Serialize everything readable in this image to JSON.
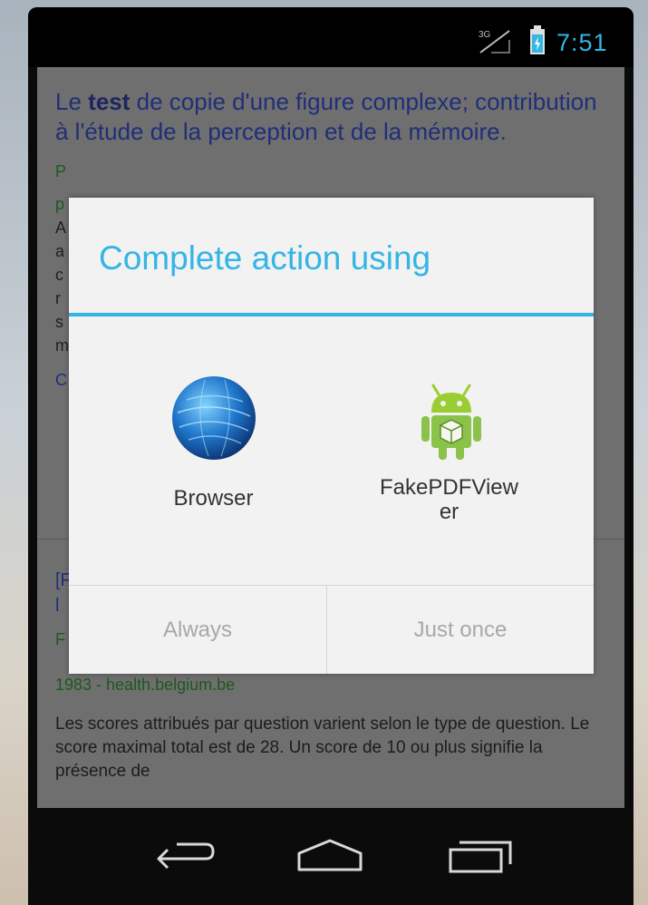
{
  "status_bar": {
    "network": "3G",
    "time": "7:51",
    "accent": "#33b5e5"
  },
  "background_page": {
    "result1": {
      "title_prefix": "Le ",
      "title_bold": "test",
      "title_rest": " de copie d'une figure complexe; contribution à l'étude de la perception et de la mémoire.",
      "partial_green_lines": [
        "P",
        "p"
      ],
      "partial_lines": [
        "A",
        "a",
        "c",
        "r",
        "s",
        "m"
      ],
      "partial_link": "C"
    },
    "result2": {
      "title_partial": "[F",
      "title_partial2": "l",
      "source_partial": "F",
      "source_line": "1983 - health.belgium.be",
      "snippet": "Les scores attribués par question varient selon le type de question. Le score maximal total est de 28. Un score de 10 ou plus signifie la présence de"
    }
  },
  "dialog": {
    "title": "Complete action using",
    "apps": [
      {
        "label": "Browser",
        "icon": "browser-globe-icon"
      },
      {
        "label": "FakePDFView\ner",
        "icon": "android-robot-icon"
      }
    ],
    "buttons": {
      "always": "Always",
      "just_once": "Just once"
    }
  },
  "nav_bar": {
    "buttons": [
      "back-icon",
      "home-icon",
      "recent-apps-icon"
    ]
  }
}
